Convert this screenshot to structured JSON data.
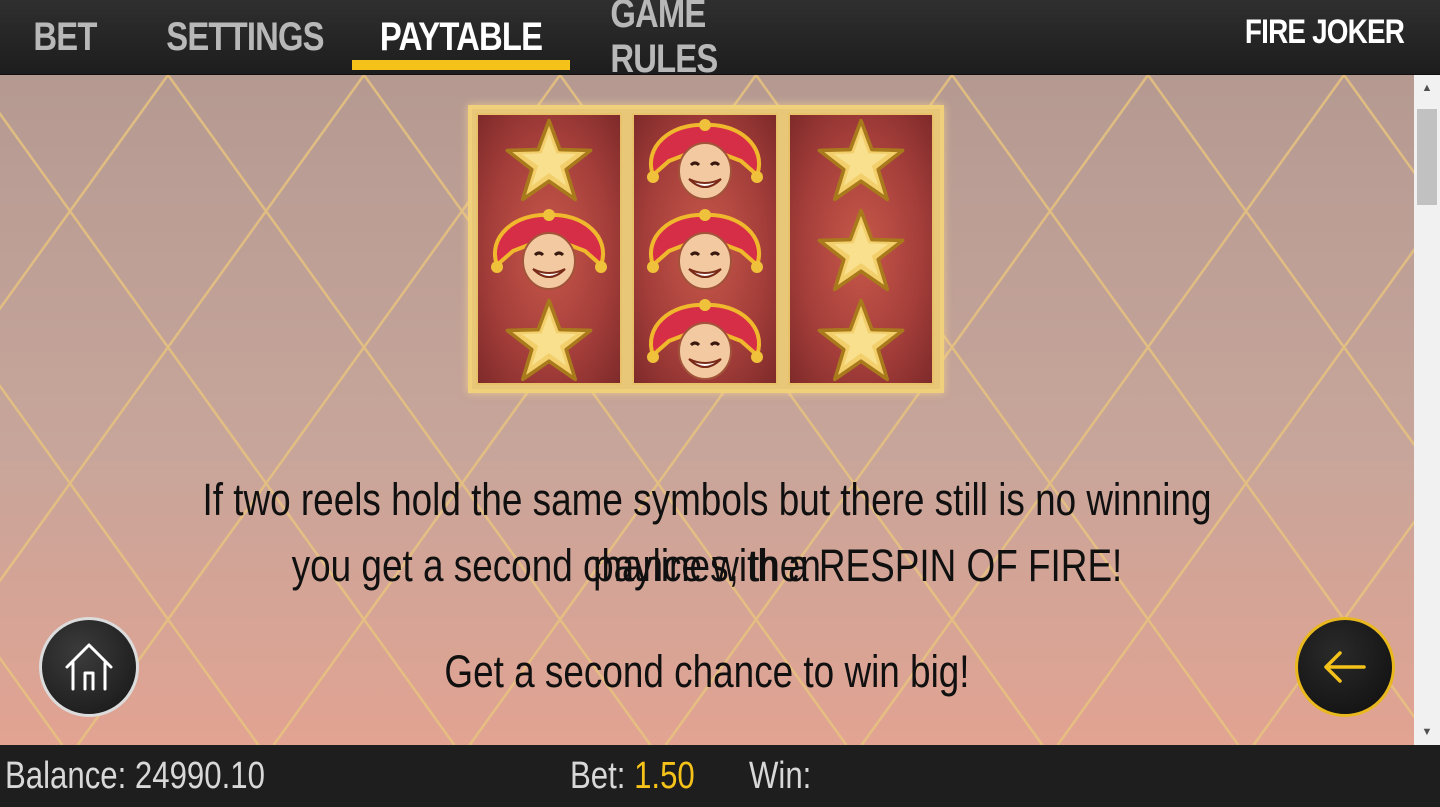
{
  "nav": {
    "tabs": [
      {
        "label": "BET"
      },
      {
        "label": "SETTINGS"
      },
      {
        "label": "PAYTABLE",
        "active": true
      },
      {
        "label": "GAME RULES"
      }
    ],
    "game_title": "FIRE JOKER"
  },
  "reels": {
    "columns": [
      [
        "star",
        "joker",
        "star"
      ],
      [
        "joker",
        "joker",
        "joker"
      ],
      [
        "star",
        "star",
        "star"
      ]
    ]
  },
  "content": {
    "paragraph_line1": "If two reels hold the same symbols but there still is no winning paylines, then",
    "paragraph_line2": "you get a second chance with a RESPIN OF FIRE!",
    "tagline": "Get a second chance to win big!"
  },
  "buttons": {
    "home": "home-icon",
    "back": "arrow-left-icon"
  },
  "footer": {
    "balance_label": "Balance:",
    "balance_value": "24990.10",
    "bet_label": "Bet:",
    "bet_value": "1.50",
    "win_label": "Win:",
    "win_value": ""
  },
  "colors": {
    "accent": "#f5c21a",
    "topbar": "#262626",
    "footer": "#1e1e1e",
    "reel": "#a43e3a"
  }
}
